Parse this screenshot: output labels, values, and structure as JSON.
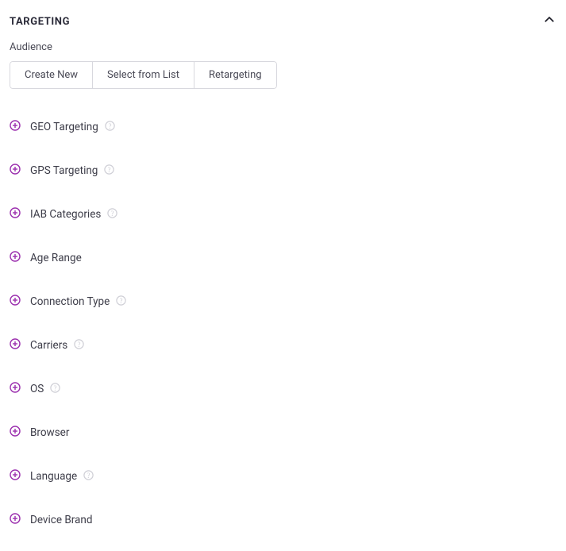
{
  "panel": {
    "title": "TARGETING"
  },
  "audience": {
    "label": "Audience",
    "buttons": {
      "create": "Create New",
      "select": "Select from List",
      "retarget": "Retargeting"
    }
  },
  "options": [
    {
      "label": "GEO Targeting",
      "help": true
    },
    {
      "label": "GPS Targeting",
      "help": true
    },
    {
      "label": "IAB Categories",
      "help": true
    },
    {
      "label": "Age Range",
      "help": false
    },
    {
      "label": "Connection Type",
      "help": true
    },
    {
      "label": "Carriers",
      "help": true
    },
    {
      "label": "OS",
      "help": true
    },
    {
      "label": "Browser",
      "help": false
    },
    {
      "label": "Language",
      "help": true
    },
    {
      "label": "Device Brand",
      "help": false
    }
  ]
}
